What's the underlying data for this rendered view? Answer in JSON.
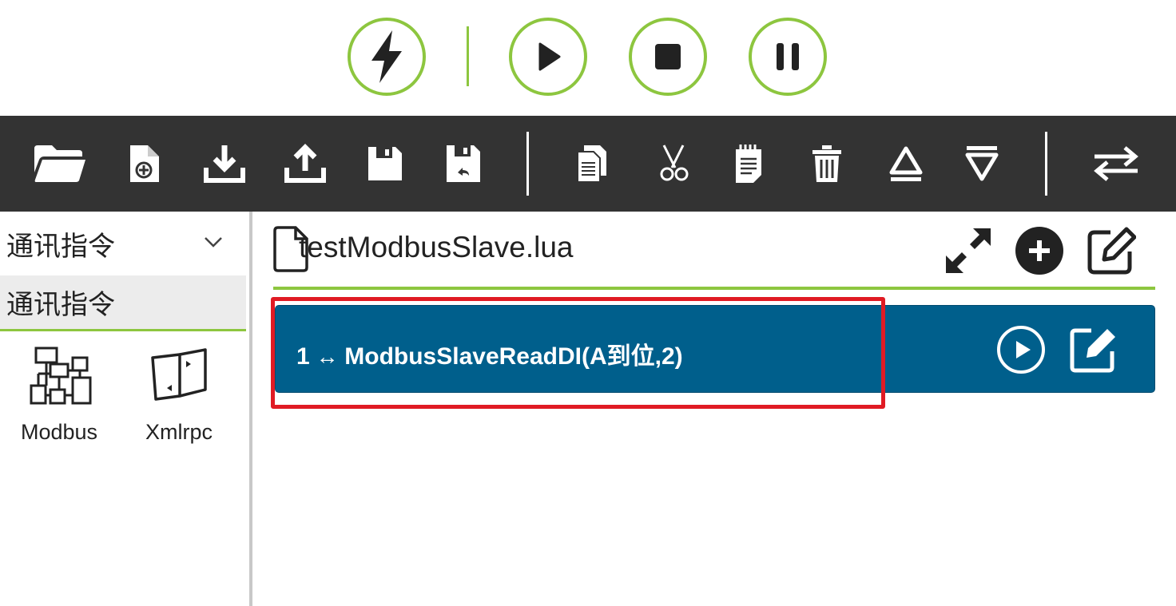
{
  "run_controls": {
    "buttons": [
      {
        "name": "lightning-icon",
        "label": "flash"
      },
      {
        "name": "play-icon",
        "label": "run"
      },
      {
        "name": "stop-icon",
        "label": "stop"
      },
      {
        "name": "pause-icon",
        "label": "pause"
      }
    ],
    "accent_color": "#8dc63f"
  },
  "toolbar": {
    "background": "#333333",
    "icons": [
      "open-folder-icon",
      "new-file-icon",
      "download-icon",
      "upload-icon",
      "save-icon",
      "save-as-icon",
      "copy-icon",
      "cut-icon",
      "paste-icon",
      "delete-icon",
      "move-up-icon",
      "move-down-icon",
      "swap-icon"
    ]
  },
  "sidebar": {
    "dropdown_label": "通讯指令",
    "category_label": "通讯指令",
    "tools": [
      {
        "label": "Modbus",
        "icon": "modbus-network-icon"
      },
      {
        "label": "Xmlrpc",
        "icon": "xmlrpc-icon"
      }
    ]
  },
  "editor": {
    "file_name": "testModbusSlave.lua",
    "commands": [
      {
        "line": "1",
        "text": "ModbusSlaveReadDI(A到位,2)",
        "color": "#005f8c"
      }
    ],
    "highlight_color": "#e01b24"
  }
}
